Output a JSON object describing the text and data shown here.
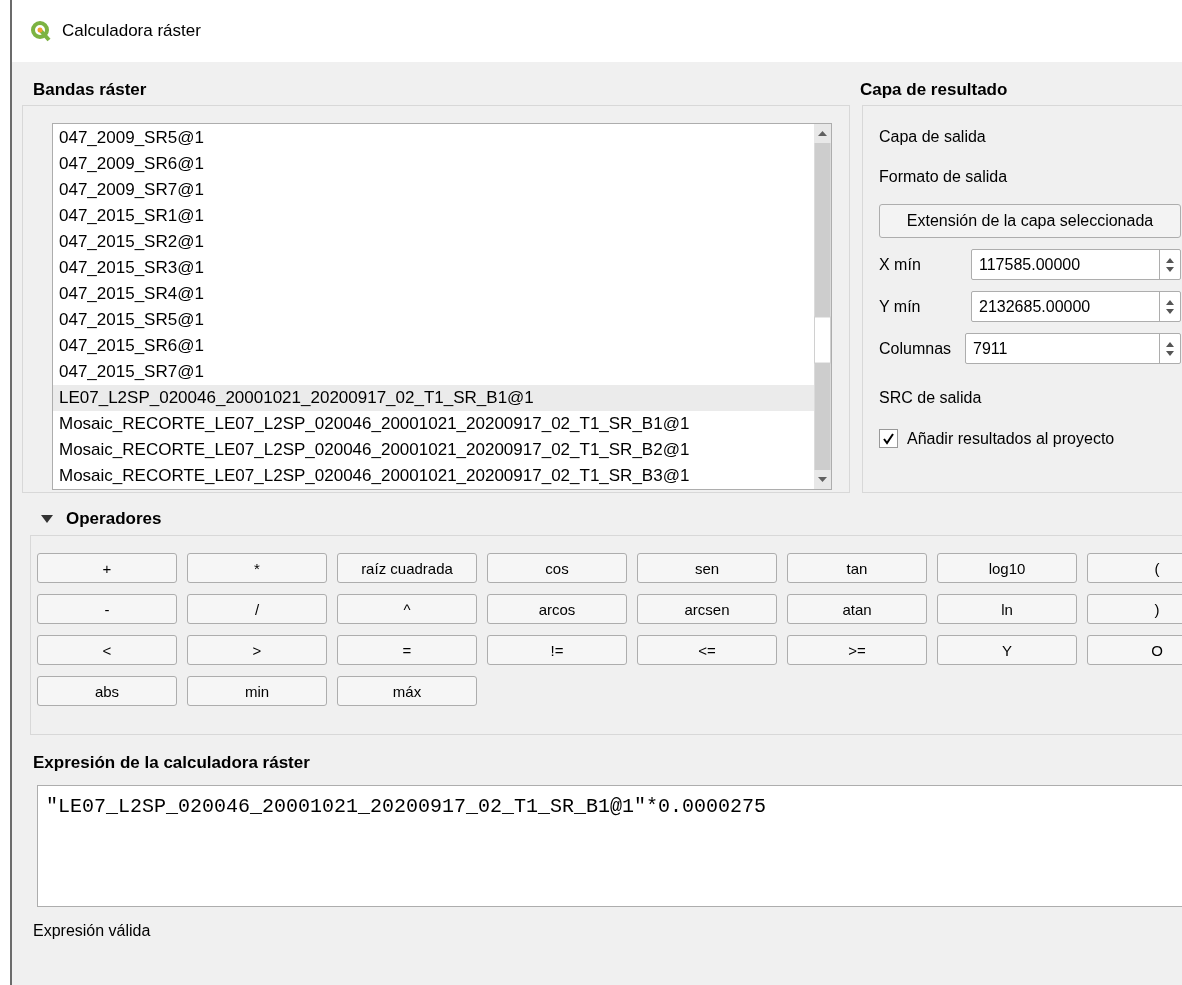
{
  "window": {
    "title": "Calculadora ráster"
  },
  "bands": {
    "heading": "Bandas ráster",
    "items": [
      {
        "label": "047_2009_SR5@1",
        "selected": false
      },
      {
        "label": "047_2009_SR6@1",
        "selected": false
      },
      {
        "label": "047_2009_SR7@1",
        "selected": false
      },
      {
        "label": "047_2015_SR1@1",
        "selected": false
      },
      {
        "label": "047_2015_SR2@1",
        "selected": false
      },
      {
        "label": "047_2015_SR3@1",
        "selected": false
      },
      {
        "label": "047_2015_SR4@1",
        "selected": false
      },
      {
        "label": "047_2015_SR5@1",
        "selected": false
      },
      {
        "label": "047_2015_SR6@1",
        "selected": false
      },
      {
        "label": "047_2015_SR7@1",
        "selected": false
      },
      {
        "label": "LE07_L2SP_020046_20001021_20200917_02_T1_SR_B1@1",
        "selected": true
      },
      {
        "label": "Mosaic_RECORTE_LE07_L2SP_020046_20001021_20200917_02_T1_SR_B1@1",
        "selected": false
      },
      {
        "label": "Mosaic_RECORTE_LE07_L2SP_020046_20001021_20200917_02_T1_SR_B2@1",
        "selected": false
      },
      {
        "label": "Mosaic_RECORTE_LE07_L2SP_020046_20001021_20200917_02_T1_SR_B3@1",
        "selected": false
      }
    ]
  },
  "result": {
    "heading": "Capa de resultado",
    "output_layer_label": "Capa de salida",
    "output_format_label": "Formato de salida",
    "extent_button": "Extensión de la capa seleccionada",
    "fields": [
      {
        "label": "X mín",
        "value": "117585.00000"
      },
      {
        "label": "Y mín",
        "value": "2132685.00000"
      },
      {
        "label": "Columnas",
        "value": "7911"
      }
    ],
    "crs_label": "SRC de salida",
    "add_to_project": {
      "label": "Añadir resultados al proyecto",
      "checked": true
    }
  },
  "operators": {
    "heading": "Operadores",
    "expanded": true,
    "buttons": [
      "+",
      "*",
      "raíz cuadrada",
      "cos",
      "sen",
      "tan",
      "log10",
      "(",
      "-",
      "/",
      "^",
      "arcos",
      "arcsen",
      "atan",
      "ln",
      ")",
      "<",
      ">",
      "=",
      "!=",
      "<=",
      ">=",
      "Y",
      "O",
      "abs",
      "min",
      "máx"
    ]
  },
  "expression": {
    "heading": "Expresión de la calculadora ráster",
    "value": "\"LE07_L2SP_020046_20001021_20200917_02_T1_SR_B1@1\"*0.0000275"
  },
  "status": "Expresión válida"
}
